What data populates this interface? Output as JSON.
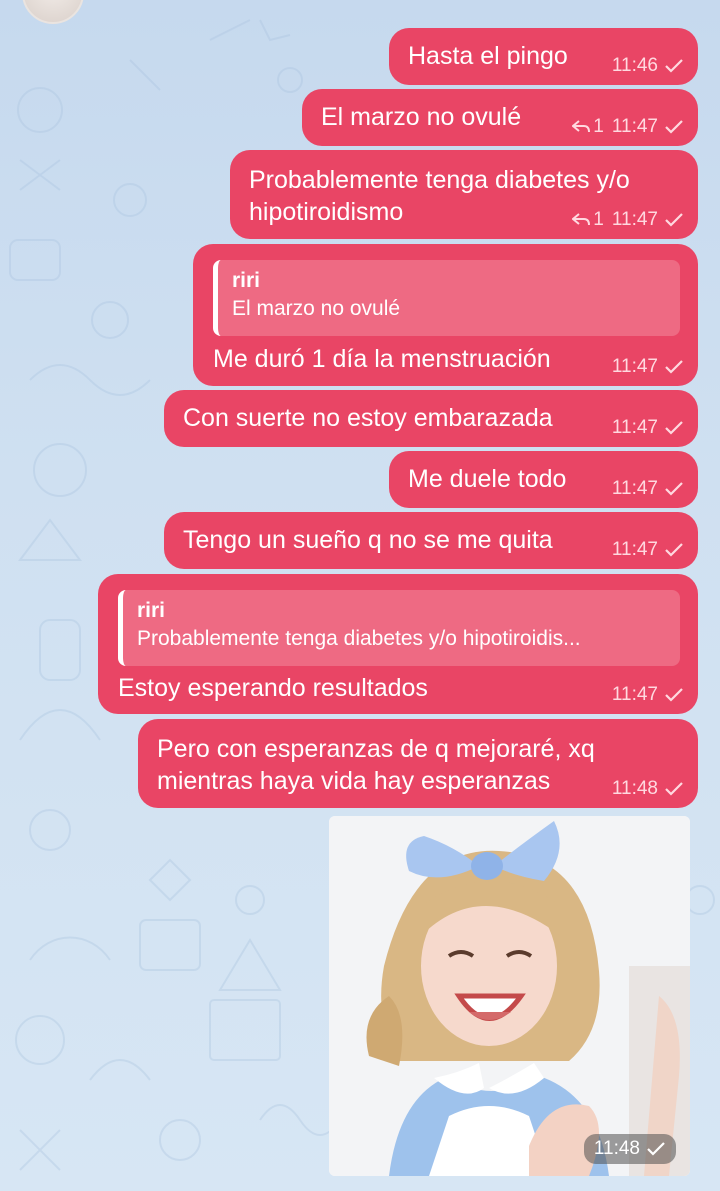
{
  "chat": {
    "messages": [
      {
        "text": "Hasta el pingo",
        "time": "11:46"
      },
      {
        "text": "El marzo no ovulé",
        "time": "11:47",
        "replies": "1"
      },
      {
        "line1": "Probablemente tenga diabetes y/o",
        "line2": "hipotiroidismo",
        "time": "11:47",
        "replies": "1"
      },
      {
        "quote_name": "riri",
        "quote_text": "El marzo no ovulé",
        "text": "Me duró 1 día la menstruación",
        "time": "11:47"
      },
      {
        "text": "Con suerte no estoy embarazada",
        "time": "11:47"
      },
      {
        "text": "Me duele todo",
        "time": "11:47"
      },
      {
        "text": "Tengo un sueño q no se me quita",
        "time": "11:47"
      },
      {
        "quote_name": "riri",
        "quote_text": "Probablemente tenga diabetes y/o hipotiroidis...",
        "text": "Estoy esperando resultados",
        "time": "11:47"
      },
      {
        "line1": "Pero con esperanzas de q mejoraré, xq",
        "line2": "mientras haya vida hay esperanzas",
        "time": "11:48"
      },
      {
        "type": "photo",
        "time": "11:48"
      }
    ]
  },
  "colors": {
    "bubble": "#e94565",
    "quote": "#ee6a83",
    "background": "#cfe0f1"
  },
  "icons": {
    "status": "check-icon",
    "reply": "reply-arrow-icon"
  }
}
